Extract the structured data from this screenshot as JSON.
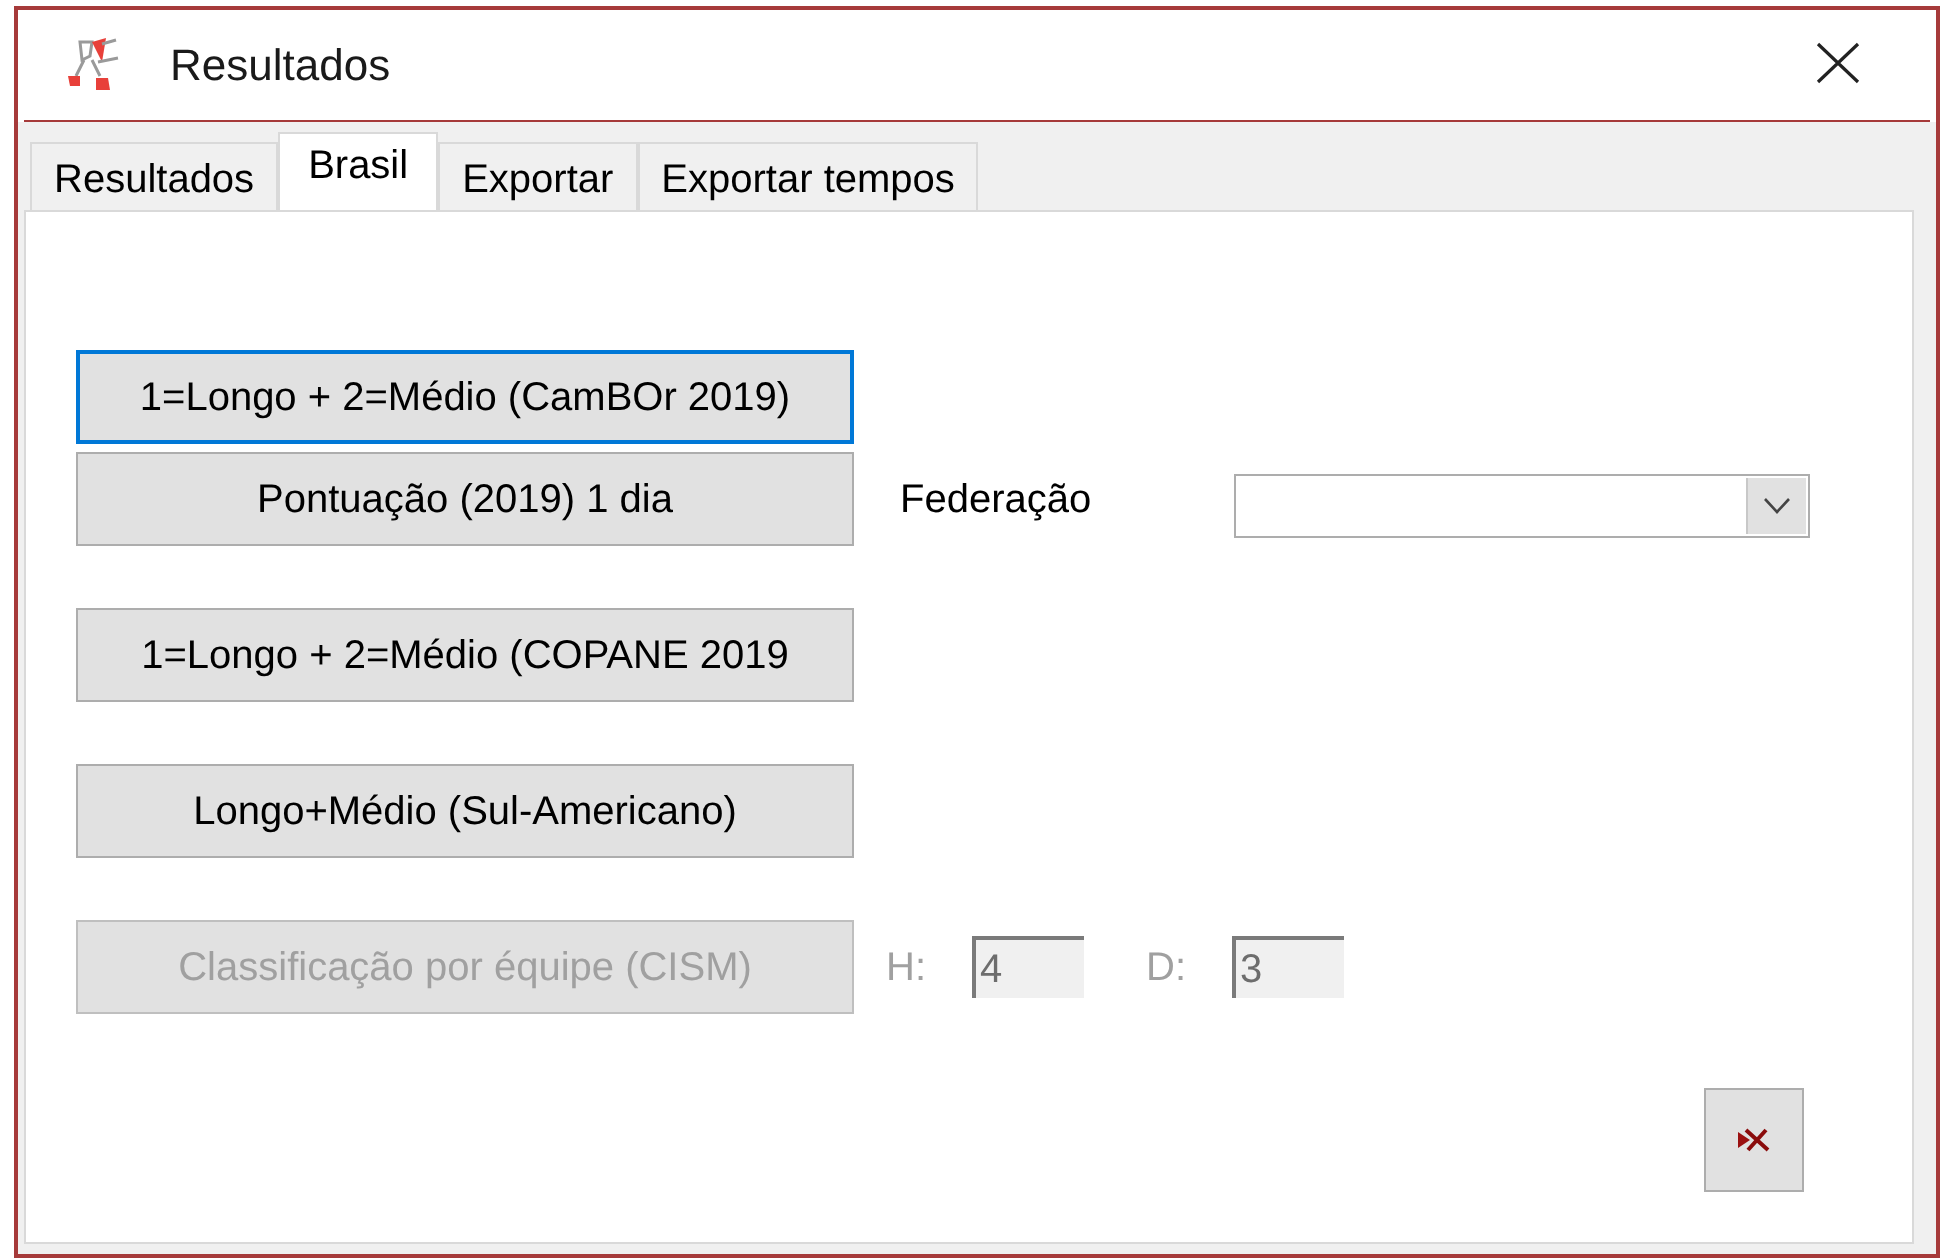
{
  "window": {
    "title": "Resultados"
  },
  "tabs": [
    {
      "label": "Resultados",
      "selected": false
    },
    {
      "label": "Brasil",
      "selected": true
    },
    {
      "label": "Exportar",
      "selected": false
    },
    {
      "label": "Exportar tempos",
      "selected": false
    }
  ],
  "rows": [
    {
      "button": {
        "label": "1=Longo + 2=Médio (CamBOr 2019)",
        "focused": true,
        "disabled": false
      }
    },
    {
      "button": {
        "label": "Pontuação (2019) 1 dia",
        "focused": false,
        "disabled": false
      },
      "combo": {
        "label": "Federação"
      }
    },
    {
      "button": {
        "label": "1=Longo + 2=Médio (COPANE 2019",
        "focused": false,
        "disabled": false
      }
    },
    {
      "button": {
        "label": "Longo+Médio (Sul-Americano)",
        "focused": false,
        "disabled": false
      }
    },
    {
      "button": {
        "label": "Classificação por équipe (CISM)",
        "focused": false,
        "disabled": true
      },
      "fields": [
        {
          "label": "H:",
          "value": "4",
          "disabled": true
        },
        {
          "label": "D:",
          "value": "3",
          "disabled": true
        }
      ]
    }
  ]
}
